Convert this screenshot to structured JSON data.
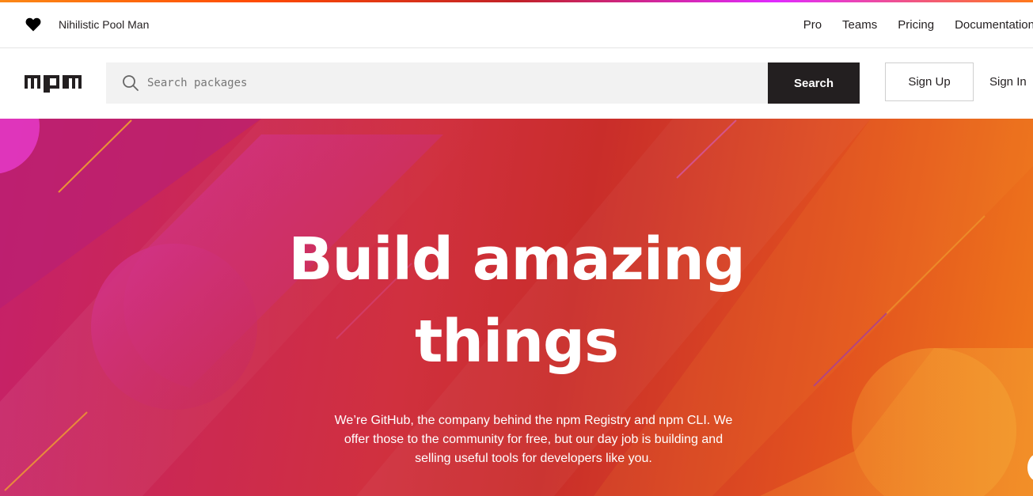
{
  "top_nav": {
    "user_name": "Nihilistic Pool Man",
    "links": [
      "Pro",
      "Teams",
      "Pricing",
      "Documentation"
    ]
  },
  "search": {
    "placeholder": "Search packages",
    "button_label": "Search"
  },
  "auth": {
    "sign_up": "Sign Up",
    "sign_in": "Sign In"
  },
  "hero": {
    "title_line1": "Build amazing",
    "title_line2": "things",
    "subtitle": "We’re GitHub, the company behind the npm Registry and npm CLI. We offer those to the community for free, but our day job is building and selling useful tools for developers like you."
  },
  "colors": {
    "brand_dark": "#231f20",
    "hero_pink": "#c5206a",
    "hero_red": "#d0303f",
    "hero_orange": "#f07a1b"
  },
  "icons": [
    "heart-icon",
    "npm-logo",
    "search-icon"
  ]
}
